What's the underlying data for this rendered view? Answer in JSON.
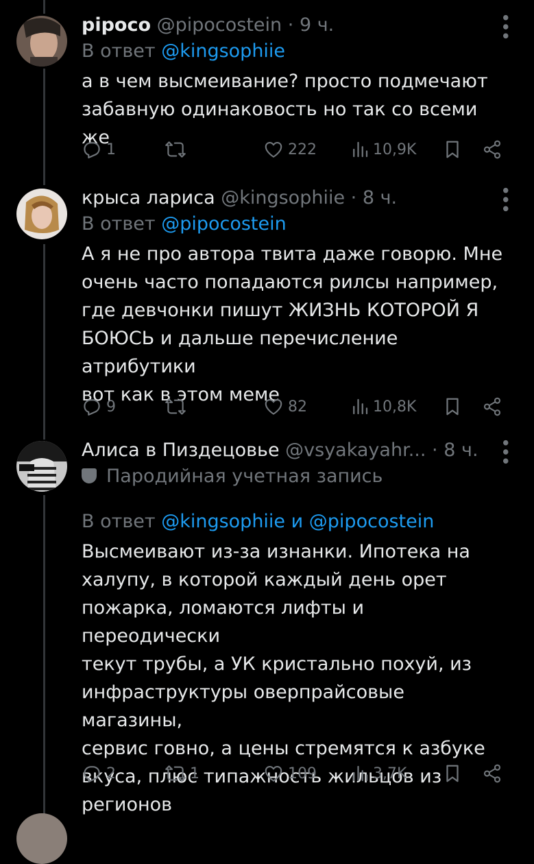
{
  "tweets": [
    {
      "display_name": "pipoco",
      "handle": "@pipocostein",
      "time": "9 ч.",
      "reply_prefix": "В ответ",
      "reply_mention_1": "@kingsophiie",
      "text_lines": [
        "а в чем высмеивание? просто подмечают",
        "забавную одинаковость но так со всеми же"
      ],
      "stats": {
        "replies": "1",
        "reposts": "",
        "likes": "222",
        "views": "10,9K"
      }
    },
    {
      "display_name": "крыса лариса",
      "handle": "@kingsophiie",
      "time": "8 ч.",
      "reply_prefix": "В ответ",
      "reply_mention_1": "@pipocostein",
      "text_lines": [
        "А я не про автора твита даже говорю. Мне",
        "очень часто попадаются рилсы например,",
        "где девчонки пишут ЖИЗНЬ КОТОРОЙ Я",
        "БОЮСЬ и дальше перечисление атрибутики",
        "вот как в этом меме"
      ],
      "stats": {
        "replies": "9",
        "reposts": "",
        "likes": "82",
        "views": "10,8K"
      }
    },
    {
      "display_name": "Алиса в Пиздецовье",
      "handle": "@vsyakayahr...",
      "time": "8 ч.",
      "parody_label": "Пародийная учетная запись",
      "reply_prefix": "В ответ",
      "reply_mention_1": "@kingsophiie",
      "reply_and": "и",
      "reply_mention_2": "@pipocostein",
      "text_lines": [
        "Высмеивают из-за изнанки. Ипотека на",
        "халупу, в которой каждый день орет",
        "пожарка, ломаются лифты и переодически",
        "текут трубы, а УК кристально похуй, из",
        "инфраструктуры оверпрайсовые магазины,",
        "сервис говно, а цены стремятся к азбуке",
        "вкуса, плюс типажность жильцов из",
        "регионов"
      ],
      "stats": {
        "replies": "2",
        "reposts": "1",
        "likes": "109",
        "views": "3,7K"
      }
    }
  ],
  "dot_separator": "·",
  "icons": [
    "reply-icon",
    "repost-icon",
    "like-icon",
    "views-icon",
    "bookmark-icon",
    "share-icon",
    "more-icon",
    "parody-mask-icon"
  ],
  "colors": {
    "background": "#000000",
    "text": "#e7e9ea",
    "muted": "#71767b",
    "link": "#1d9bf0",
    "thread_line": "#333639"
  }
}
